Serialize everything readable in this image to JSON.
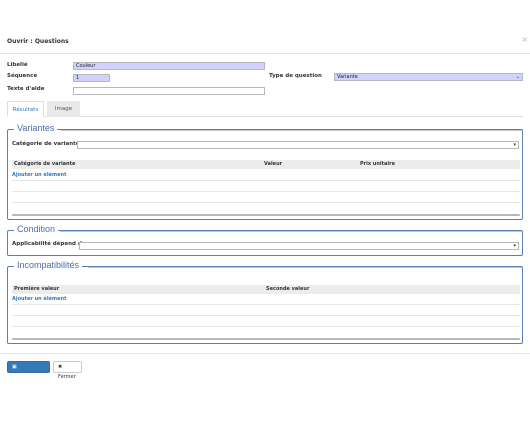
{
  "modal": {
    "title": "Ouvrir : Questions",
    "close": "×"
  },
  "form": {
    "libelle_label": "Libellé",
    "libelle_value": "Couleur",
    "sequence_label": "Séquence",
    "sequence_value": "1",
    "texte_aide_label": "Texte d'aide",
    "texte_aide_value": "",
    "type_label": "Type de question",
    "type_value": "Variante"
  },
  "tabs": [
    {
      "label": "Résultats"
    },
    {
      "label": "Image"
    }
  ],
  "variantes": {
    "legend": "Variantes",
    "categorie_label": "Catégorie de variante",
    "columns": [
      "Catégorie de variante",
      "Valeur",
      "Prix unitaire"
    ],
    "add_label": "Ajouter un élément"
  },
  "condition": {
    "legend": "Condition",
    "applicabilite_label": "Applicabilité dépend de"
  },
  "incompatibilites": {
    "legend": "Incompatibilités",
    "columns": [
      "Première valeur",
      "Seconde valeur"
    ],
    "add_label": "Ajouter un élément"
  },
  "footer": {
    "save_label": "Sauvegarder",
    "close_label": "Fermer"
  },
  "icons": {
    "save": "floppy-icon",
    "close": "close-icon",
    "dropdown": "caret-down-icon"
  },
  "colors": {
    "accent": "#337ab7",
    "legend": "#4a6fa5",
    "required_field": "#d2d2ff"
  }
}
